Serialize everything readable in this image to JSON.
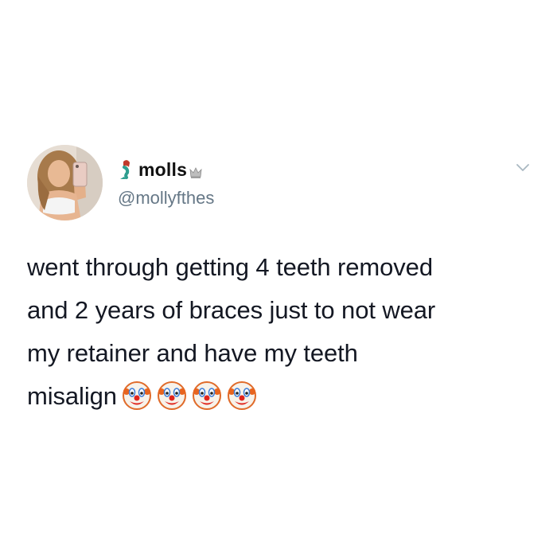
{
  "user": {
    "display_name": "molls",
    "handle": "@mollyfthes",
    "name_emojis": [
      "mermaid-emoji",
      "crown-emoji"
    ],
    "avatar": "profile-photo-selfie"
  },
  "tweet": {
    "lines": [
      "went through getting 4 teeth removed",
      "and 2 years of braces just to not wear",
      "my retainer and have my teeth",
      "misalign"
    ],
    "emojis": [
      "clown-face",
      "clown-face",
      "clown-face",
      "clown-face"
    ]
  },
  "menu": {
    "icon": "chevron-down-icon"
  },
  "colors": {
    "text": "#141823",
    "handle": "#657786",
    "background": "#ffffff",
    "chevron": "#aab8c2"
  }
}
